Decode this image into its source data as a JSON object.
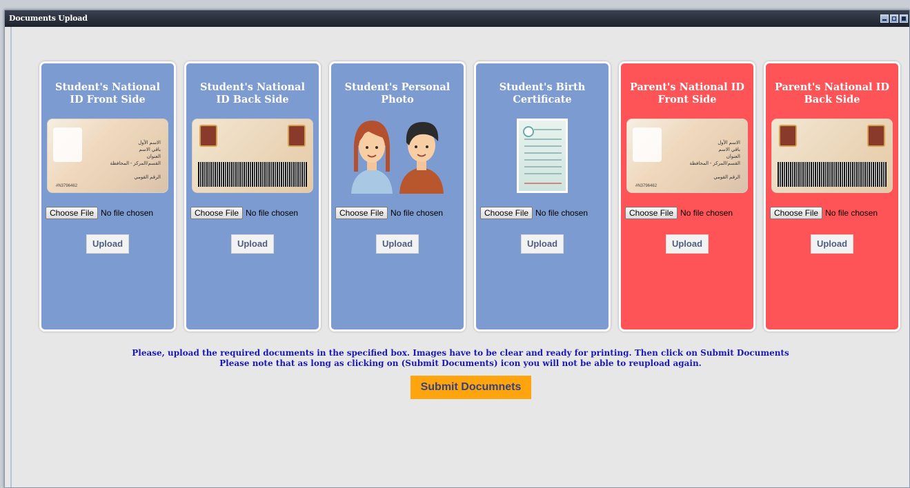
{
  "window": {
    "title": "Documents Upload"
  },
  "colors": {
    "student_card": "#7c9bd0",
    "parent_card": "#ff5457",
    "submit": "#fda40f",
    "instructions": "#1a1ab8"
  },
  "cards": [
    {
      "title": "Student's National ID Front Side",
      "image": "id-front-card",
      "choose_label": "Choose File",
      "file_status": "No file chosen",
      "upload_label": "Upload"
    },
    {
      "title": "Student's National ID Back Side",
      "image": "id-back-card",
      "choose_label": "Choose File",
      "file_status": "No file chosen",
      "upload_label": "Upload"
    },
    {
      "title": "Student's Personal Photo",
      "image": "personal-photo-people",
      "choose_label": "Choose File",
      "file_status": "No file chosen",
      "upload_label": "Upload"
    },
    {
      "title": "Student's Birth Certificate",
      "image": "birth-certificate",
      "choose_label": "Choose File",
      "file_status": "No file chosen",
      "upload_label": "Upload"
    },
    {
      "title": "Parent's National ID Front Side",
      "image": "id-front-card",
      "choose_label": "Choose File",
      "file_status": "No file chosen",
      "upload_label": "Upload"
    },
    {
      "title": "Parent's National ID Back Side",
      "image": "id-back-card",
      "choose_label": "Choose File",
      "file_status": "No file chosen",
      "upload_label": "Upload"
    }
  ],
  "instructions": {
    "line1": "Please, upload the required documents in the specified box. Images have to be clear and ready for printing. Then click on Submit Documents",
    "line2": "Please note that as long as clicking on (Submit Documents) icon you will not be able to reupload again."
  },
  "submit": {
    "label": "Submit Documnets"
  }
}
